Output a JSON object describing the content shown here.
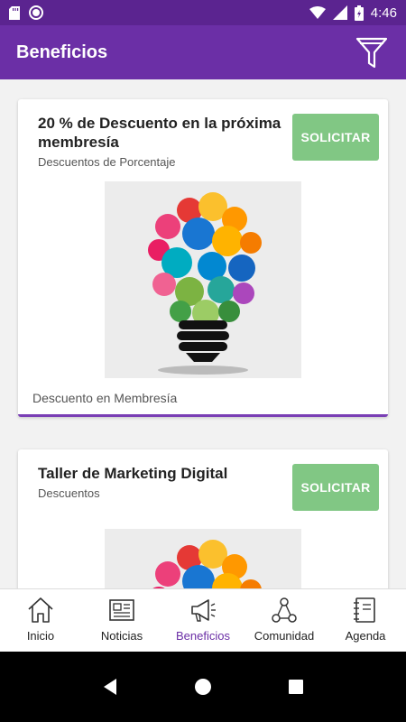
{
  "status_bar": {
    "time": "4:46"
  },
  "app_bar": {
    "title": "Beneficios"
  },
  "benefits": [
    {
      "title": "20 % de Descuento en la próxima membresía",
      "subtitle": "Descuentos de Porcentaje",
      "button": "SOLICITAR",
      "footer": "Descuento en Membresía"
    },
    {
      "title": "Taller de Marketing Digital",
      "subtitle": "Descuentos",
      "button": "SOLICITAR"
    }
  ],
  "bottom_nav": [
    {
      "label": "Inicio",
      "icon": "home-icon"
    },
    {
      "label": "Noticias",
      "icon": "newspaper-icon"
    },
    {
      "label": "Beneficios",
      "icon": "megaphone-icon",
      "active": true
    },
    {
      "label": "Comunidad",
      "icon": "network-icon"
    },
    {
      "label": "Agenda",
      "icon": "notebook-icon"
    }
  ],
  "colors": {
    "primary": "#6b2fa6",
    "status_bar": "#5b2490",
    "button": "#81c784",
    "active_label": "#6b2fa6"
  }
}
